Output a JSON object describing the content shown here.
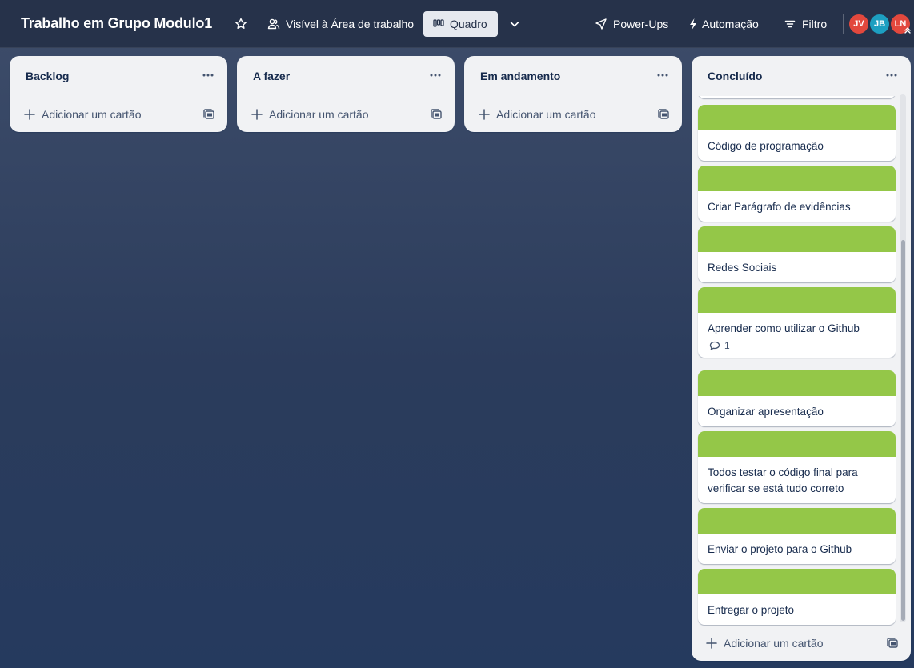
{
  "header": {
    "board_title": "Trabalho em Grupo Modulo1",
    "visibility_label": "Visível à Área de trabalho",
    "view_label": "Quadro",
    "powerups_label": "Power-Ups",
    "automation_label": "Automação",
    "filter_label": "Filtro",
    "members": [
      {
        "initials": "JV",
        "color": "#e2483d"
      },
      {
        "initials": "JB",
        "color": "#1d9fc1"
      },
      {
        "initials": "LN",
        "color": "#e2483d"
      }
    ]
  },
  "lists": [
    {
      "title": "Backlog",
      "add_card_label": "Adicionar um cartão"
    },
    {
      "title": "A fazer",
      "add_card_label": "Adicionar um cartão"
    },
    {
      "title": "Em andamento",
      "add_card_label": "Adicionar um cartão"
    },
    {
      "title": "Concluído",
      "add_card_label": "Adicionar um cartão",
      "cover_color": "#94c748",
      "cards": [
        {
          "title": "Código de programação"
        },
        {
          "title": "Criar Parágrafo de evidências"
        },
        {
          "title": "Redes Sociais"
        },
        {
          "title": "Aprender como utilizar o Github",
          "comments": "1"
        },
        {
          "title": "Organizar apresentação"
        },
        {
          "title": "Todos testar o código final para verificar se está tudo correto"
        },
        {
          "title": "Enviar o projeto para o Github"
        },
        {
          "title": "Entregar o projeto"
        }
      ]
    }
  ]
}
